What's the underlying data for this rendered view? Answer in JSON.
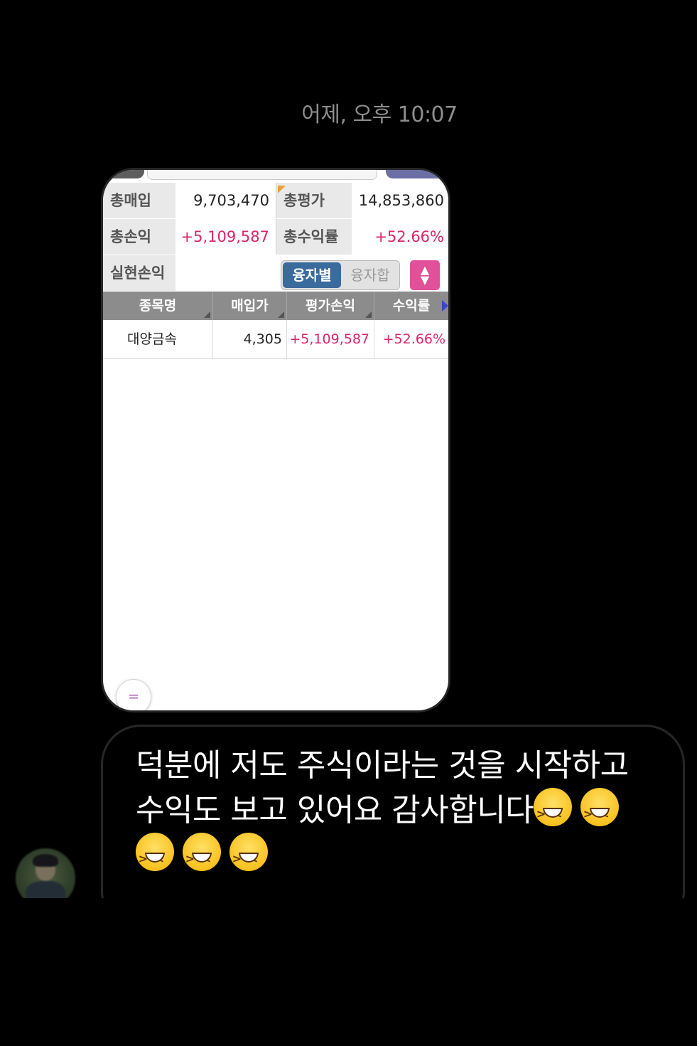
{
  "timestamp": "어제, 오후 10:07",
  "screenshot": {
    "summary": [
      {
        "label": "총매입",
        "value": "9,703,470",
        "label2": "총평가",
        "value2": "14,853,860"
      },
      {
        "label": "총손익",
        "value": "+5,109,587",
        "label2": "총수익률",
        "value2": "+52.66%"
      },
      {
        "label": "실현손익",
        "value": ""
      }
    ],
    "toggle_on": "융자별",
    "toggle_off": "융자합",
    "table": {
      "headers": [
        "종목명",
        "매입가",
        "평가손익",
        "수익률"
      ],
      "rows": [
        {
          "name": "대양금속",
          "price": "4,305",
          "pnl": "+5,109,587",
          "rate": "+52.66%"
        }
      ]
    },
    "menu_glyph": "="
  },
  "message": {
    "text": "덕분에 저도 주식이라는 것을 시작하고 수익도 보고 있어요 감사합니다",
    "emoji_name": "grinning-squinting-face-icon",
    "emoji_count": 5
  },
  "colors": {
    "accent_pink": "#d8246a",
    "toggle_blue": "#3b6a9c",
    "sort_pink": "#e0519a"
  }
}
